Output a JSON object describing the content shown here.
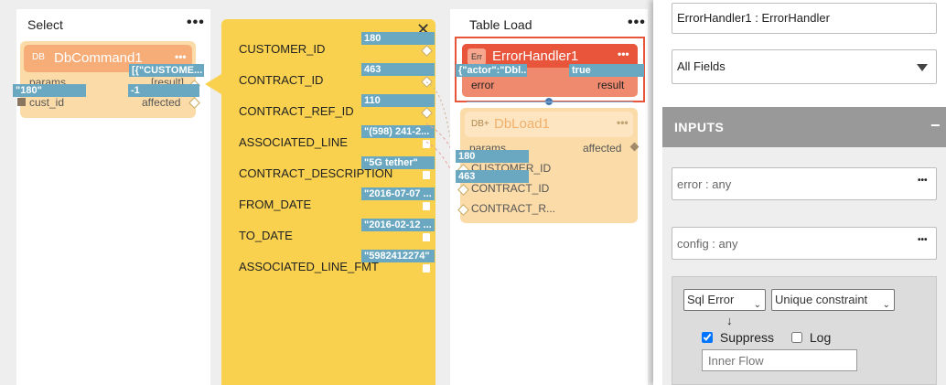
{
  "select_col": {
    "title": "Select",
    "node_icon": "DB",
    "node_name": "DbCommand1",
    "params_label": "params",
    "result_label": "[result]",
    "result_value": "[{\"CUSTOME...",
    "cust_id_label": "cust_id",
    "cust_id_value": "\"180\"",
    "affected_label": "affected",
    "affected_value": "-1"
  },
  "result_fields": [
    {
      "label": "CUSTOMER_ID",
      "value": "180"
    },
    {
      "label": "CONTRACT_ID",
      "value": "463"
    },
    {
      "label": "CONTRACT_REF_ID",
      "value": "110"
    },
    {
      "label": "ASSOCIATED_LINE",
      "value": "\"(598) 241-2..."
    },
    {
      "label": "CONTRACT_DESCRIPTION",
      "value": "\"5G tether\""
    },
    {
      "label": "FROM_DATE",
      "value": "\"2016-07-07 ..."
    },
    {
      "label": "TO_DATE",
      "value": "\"2016-02-12 ..."
    },
    {
      "label": "ASSOCIATED_LINE_FMT",
      "value": "\"5982412274\""
    }
  ],
  "table_load": {
    "title": "Table Load",
    "error_handler": {
      "icon": "Err",
      "name": "ErrorHandler1",
      "error_label": "error",
      "error_value": "{\"actor\":\"Dbl...",
      "result_label": "result",
      "result_value": "true"
    },
    "db_load": {
      "icon": "DB+",
      "name": "DbLoad1",
      "params_label": "params",
      "affected_label": "affected",
      "fields": [
        {
          "label": "CUSTOMER_ID",
          "value": "180"
        },
        {
          "label": "CONTRACT_ID",
          "value": "463"
        },
        {
          "label": "CONTRACT_R...",
          "value": ""
        }
      ]
    }
  },
  "panel": {
    "name_value": "ErrorHandler1 : ErrorHandler",
    "filter_value": "All Fields",
    "inputs_header": "INPUTS",
    "collapse_symbol": "−",
    "error_input": "error : any",
    "config_input": "config : any",
    "error_type": "Sql Error",
    "error_subtype": "Unique constraint",
    "arrow": "↓",
    "suppress_label": "Suppress",
    "suppress_checked": true,
    "log_label": "Log",
    "log_checked": false,
    "inner_flow_placeholder": "Inner Flow"
  },
  "icons": [
    "more-dots-icon",
    "close-icon",
    "dropdown-arrow-icon",
    "minus-icon"
  ],
  "colors": {
    "accent_blue": "#6aa7c0",
    "yellow": "#f9d14e",
    "peach": "#fbdba8",
    "orange_node": "#f6ad78",
    "error_red": "#e8553a",
    "header_gray": "#999999"
  }
}
